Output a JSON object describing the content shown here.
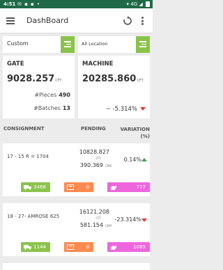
{
  "status_bar": {
    "time": "4:51",
    "network": "4G"
  },
  "app_bar": {
    "title": "DashBoard"
  },
  "filters": {
    "type_value": "Custom",
    "location_value": "All Location"
  },
  "gate": {
    "title": "GATE",
    "value": "9028.257",
    "unit": "CFT",
    "pieces_label": "#Pieces",
    "pieces_value": "490",
    "batches_label": "#Batches",
    "batches_value": "13"
  },
  "machine": {
    "title": "MACHINE",
    "value": "20285.860",
    "unit": "CFT",
    "variation": "~ -5.314%"
  },
  "table_header": {
    "consignment": "CONSIGNMENT",
    "pending": "PENDING",
    "variation": "VARIATION (%)"
  },
  "rows": [
    {
      "consignment": "17 - 15 R = 1704",
      "pending_cft": "10828.827",
      "cft_unit": "CFT",
      "pending_cbm": "390.369",
      "cbm_unit": "CBM",
      "variation": "0.14%",
      "trend": "up",
      "chip_green": "3468",
      "chip_orange": "0",
      "chip_pink": "777"
    },
    {
      "consignment": "18 - 27- AMROSE  625",
      "pending_cft": "16121.208",
      "cft_unit": "CFT",
      "pending_cbm": "581.154",
      "cbm_unit": "CBM",
      "variation": "-23.314%",
      "trend": "down",
      "chip_green": "1144",
      "chip_orange": "0",
      "chip_pink": "1085"
    }
  ]
}
